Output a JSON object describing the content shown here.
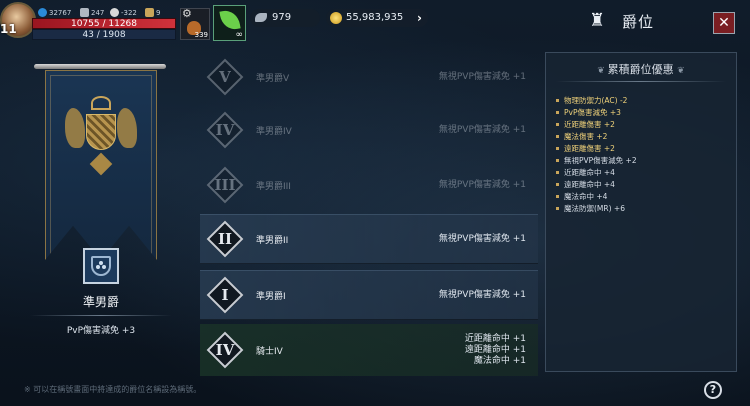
{
  "hud": {
    "level": "11",
    "stats": [
      "32767",
      "247",
      "-322",
      "9"
    ],
    "hp": "10755 / 11268",
    "mp": "43 / 1908",
    "bag_count": "339",
    "leaf_label": "∞",
    "wings": "979",
    "gold": "55,983,935"
  },
  "window": {
    "title": "爵位",
    "close": "✕"
  },
  "current": {
    "name": "準男爵",
    "benefit": "PvP傷害減免 +3"
  },
  "ranks": [
    {
      "numeral": "V",
      "name": "準男爵V",
      "benefit": [
        "無視PVP傷害減免 +1"
      ],
      "state": "locked"
    },
    {
      "numeral": "IV",
      "name": "準男爵IV",
      "benefit": [
        "無視PVP傷害減免 +1"
      ],
      "state": "locked"
    },
    {
      "numeral": "III",
      "name": "準男爵III",
      "benefit": [
        "無視PVP傷害減免 +1"
      ],
      "state": "locked"
    },
    {
      "numeral": "II",
      "name": "準男爵II",
      "benefit": [
        "無視PVP傷害減免 +1"
      ],
      "state": "active"
    },
    {
      "numeral": "I",
      "name": "準男爵I",
      "benefit": [
        "無視PVP傷害減免 +1"
      ],
      "state": "active"
    },
    {
      "numeral": "IV",
      "name": "騎士IV",
      "benefit": [
        "近距離命中 +1",
        "遠距離命中 +1",
        "魔法命中 +1"
      ],
      "state": "next"
    }
  ],
  "accumulated": {
    "title": "累積爵位優惠",
    "items": [
      {
        "text": "物理防禦力(AC) -2",
        "hl": true
      },
      {
        "text": "PvP傷害減免 +3",
        "hl": true
      },
      {
        "text": "近距離傷害 +2",
        "hl": true
      },
      {
        "text": "魔法傷害 +2",
        "hl": true
      },
      {
        "text": "遠距離傷害 +2",
        "hl": true
      },
      {
        "text": "無視PVP傷害減免 +2",
        "hl": false
      },
      {
        "text": "近距離命中 +4",
        "hl": false
      },
      {
        "text": "遠距離命中 +4",
        "hl": false
      },
      {
        "text": "魔法命中 +4",
        "hl": false
      },
      {
        "text": "魔法防禦(MR) +6",
        "hl": false
      }
    ]
  },
  "footer": {
    "note": "※ 可以在稱號畫面中將達成的爵位名稱設為稱號。",
    "help": "?"
  },
  "colors": {
    "hl": "#f0d27a",
    "accent": "#c9a55a",
    "close_bg": "#7a1e22"
  },
  "icons": [
    "mana-gem-icon",
    "sword-icon",
    "skull-icon",
    "trophy-icon",
    "gear-icon",
    "pouch-icon",
    "leaf-icon",
    "wing-icon",
    "gold-coin-icon",
    "chevron-right-icon",
    "rank-icon",
    "close-icon",
    "help-icon"
  ]
}
